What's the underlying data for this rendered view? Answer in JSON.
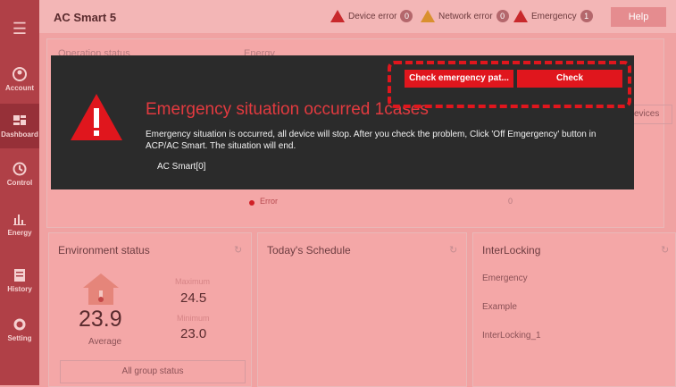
{
  "app": {
    "title": "AC Smart 5"
  },
  "alerts": {
    "device_error": {
      "label": "Device error",
      "count": "0"
    },
    "network_error": {
      "label": "Network error",
      "count": "0"
    },
    "emergency": {
      "label": "Emergency",
      "count": "1"
    }
  },
  "help_label": "Help",
  "sidebar": {
    "items": [
      {
        "label": "Account"
      },
      {
        "label": "Dashboard"
      },
      {
        "label": "Control"
      },
      {
        "label": "Energy"
      },
      {
        "label": "History"
      },
      {
        "label": "Setting"
      }
    ]
  },
  "background": {
    "operation_status": "Operation status",
    "energy": "Energy",
    "devices": "evices",
    "error_label": "Error",
    "error_value": "0"
  },
  "modal": {
    "check_path_label": "Check emergency pat...",
    "check_label": "Check",
    "title": "Emergency situation occurred 1cases",
    "message": "Emergency situation is occurred, all device will stop. After you check the problem, Click 'Off Emgergency' button in ACP/AC Smart. The situation will end.",
    "device": "AC Smart[0]"
  },
  "environment": {
    "title": "Environment status",
    "average": "23.9",
    "average_label": "Average",
    "maximum_label": "Maximum",
    "maximum": "24.5",
    "minimum_label": "Minimum",
    "minimum": "23.0",
    "all_group_label": "All group status"
  },
  "schedule": {
    "title": "Today's Schedule"
  },
  "interlocking": {
    "title": "InterLocking",
    "items": [
      "Emergency",
      "Example",
      "InterLocking_1"
    ]
  },
  "colors": {
    "accent": "#e0161d",
    "overlay": "#f0a2a2",
    "sidebar": "#b04047"
  }
}
